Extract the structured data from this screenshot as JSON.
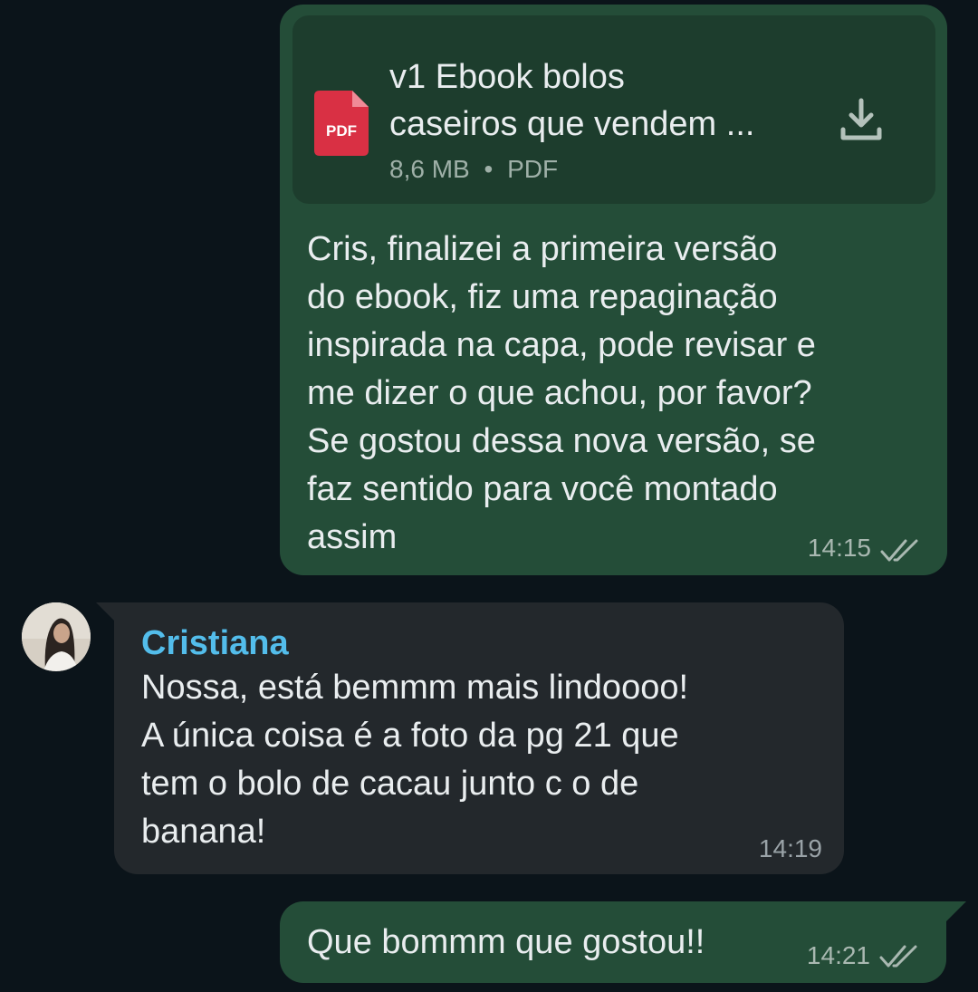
{
  "messages": [
    {
      "direction": "outgoing",
      "attachment": {
        "name": "v1 Ebook bolos\ncaseiros que vendem ...",
        "size": "8,6 MB",
        "separator": "•",
        "type": "PDF",
        "icon_label": "PDF",
        "icon": "pdf-file-icon",
        "action_icon": "download-icon"
      },
      "text": "Cris, finalizei a primeira versão\ndo ebook, fiz uma repaginação\ninspirada na capa, pode revisar e\nme dizer o que achou, por favor?\nSe gostou dessa nova versão, se\nfaz sentido para você montado\nassim",
      "time": "14:15",
      "status_icon": "double-check-icon"
    },
    {
      "direction": "incoming",
      "sender": "Cristiana",
      "avatar_icon": "avatar",
      "text": "Nossa, está bemmm mais lindoooo!\nA única coisa é a foto da pg 21 que\ntem o bolo de cacau junto c o de\nbanana!",
      "time": "14:19"
    },
    {
      "direction": "outgoing",
      "text": "Que bommm que gostou!!",
      "time": "14:21",
      "status_icon": "double-check-icon"
    }
  ],
  "colors": {
    "background": "#0b141a",
    "outgoing_bubble": "#244d38",
    "incoming_bubble": "#23282c",
    "file_card": "#1d3d2d",
    "pdf_icon": "#d93044",
    "sender_name": "#53bdeb"
  }
}
